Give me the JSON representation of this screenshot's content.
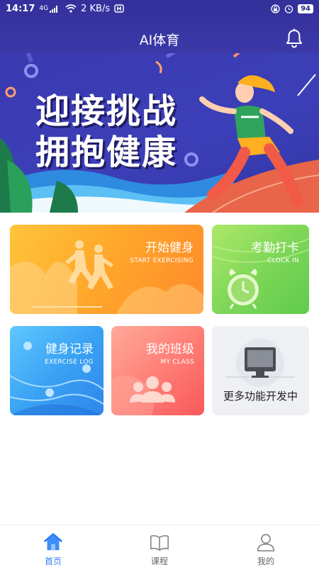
{
  "status_bar": {
    "time": "14:17",
    "signal": "4G",
    "network_speed": "2 KB/s",
    "battery": "94"
  },
  "header": {
    "title": "AI体育",
    "bell_icon": "bell-icon"
  },
  "banner": {
    "line1": "迎接挑战",
    "line2": "拥抱健康"
  },
  "cards": {
    "start": {
      "title": "开始健身",
      "subtitle": "START EXERCISING"
    },
    "clock": {
      "title": "考勤打卡",
      "subtitle": "CLOCK IN"
    },
    "log": {
      "title": "健身记录",
      "subtitle": "EXERCISE LOG"
    },
    "class": {
      "title": "我的班级",
      "subtitle": "MY CLASS"
    },
    "more": {
      "title": "更多功能开发中"
    }
  },
  "nav": {
    "items": [
      {
        "label": "首页",
        "icon": "home-icon",
        "active": true
      },
      {
        "label": "课程",
        "icon": "book-icon",
        "active": false
      },
      {
        "label": "我的",
        "icon": "user-icon",
        "active": false
      }
    ]
  },
  "colors": {
    "header_bg": "#33309c",
    "active_tab": "#2f7ef6",
    "start_card": "#ffa62a",
    "clock_card": "#7fd758",
    "log_card": "#3aa3f4",
    "class_card": "#ff8077",
    "more_card": "#eef0f4"
  }
}
